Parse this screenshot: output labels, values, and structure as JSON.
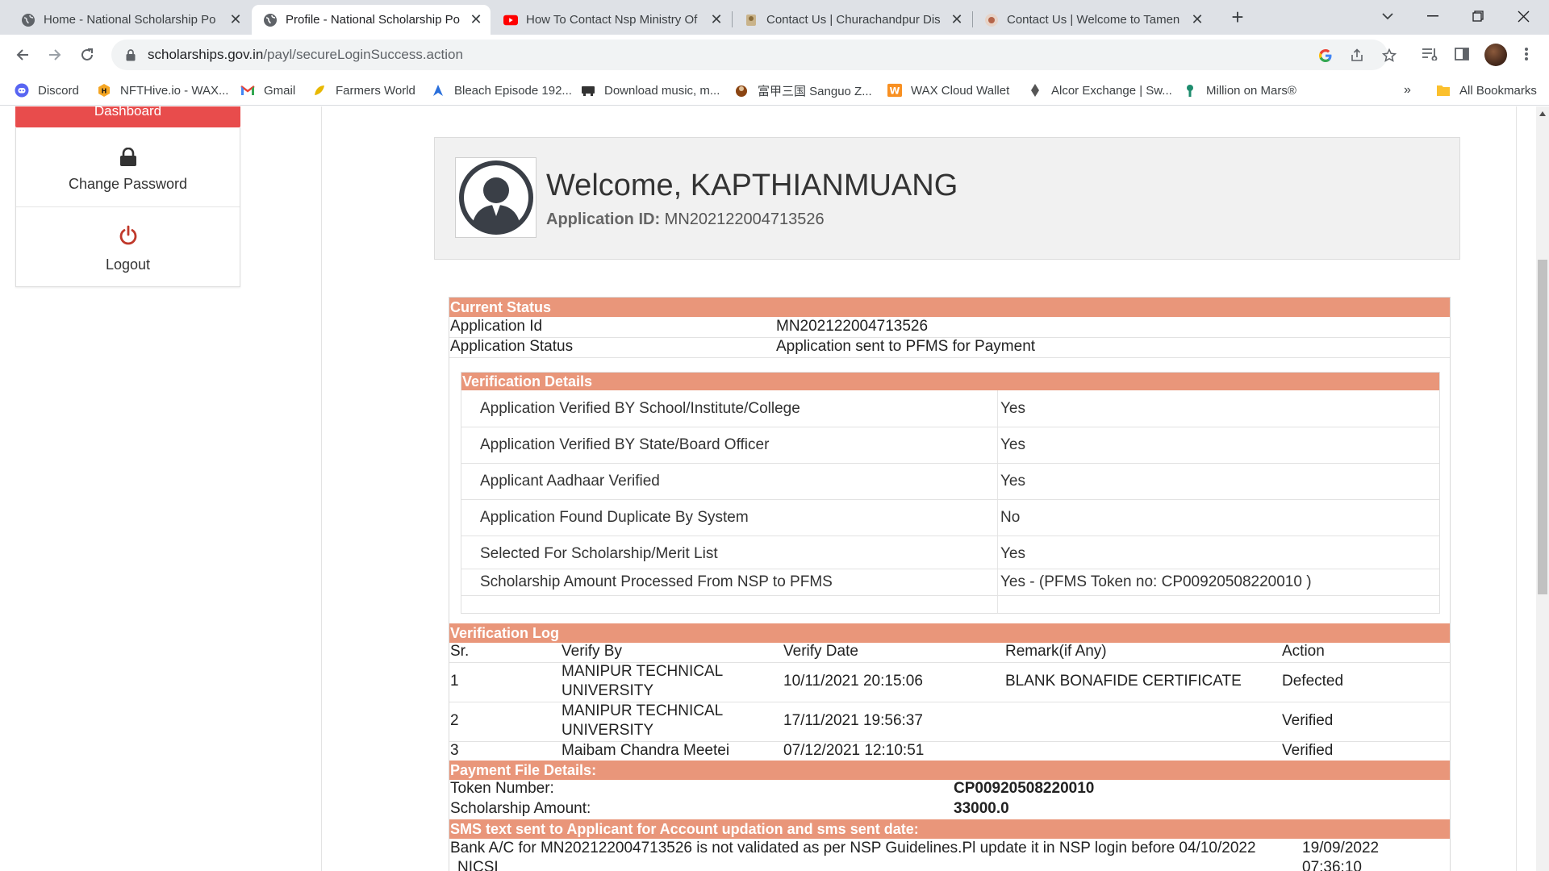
{
  "browser": {
    "tabs": [
      {
        "title": "Home - National Scholarship Po",
        "icon": "globe-icon",
        "active": false
      },
      {
        "title": "Profile - National Scholarship Po",
        "icon": "globe-icon",
        "active": true
      },
      {
        "title": "How To Contact Nsp Ministry Of",
        "icon": "youtube-icon",
        "active": false
      },
      {
        "title": "Contact Us | Churachandpur Dis",
        "icon": "emblem-icon",
        "active": false
      },
      {
        "title": "Contact Us | Welcome to Tamen",
        "icon": "emblem-icon",
        "active": false
      }
    ],
    "url_host": "scholarships.gov.in",
    "url_path": "/payl/secureLoginSuccess.action",
    "bookmarks": [
      {
        "label": "Discord",
        "icon": "discord-icon",
        "color": "#5865f2"
      },
      {
        "label": "NFTHive.io - WAX...",
        "icon": "nfthive-icon",
        "color": "#f5a623"
      },
      {
        "label": "Gmail",
        "icon": "gmail-icon",
        "color": "#ea4335"
      },
      {
        "label": "Farmers World",
        "icon": "farmers-world-icon",
        "color": "#e8b800"
      },
      {
        "label": "Bleach Episode 192...",
        "icon": "bleach-icon",
        "color": "#2a6fdb"
      },
      {
        "label": "Download music, m...",
        "icon": "download-icon",
        "color": "#333333"
      },
      {
        "label": "富甲三国 Sanguo Z...",
        "icon": "sanguo-icon",
        "color": "#8b4513"
      },
      {
        "label": "WAX Cloud Wallet",
        "icon": "wax-icon",
        "color": "#f89022"
      },
      {
        "label": "Alcor Exchange | Sw...",
        "icon": "alcor-icon",
        "color": "#555555"
      },
      {
        "label": "Million on Mars®",
        "icon": "mars-icon",
        "color": "#1e8c6e"
      }
    ],
    "all_bookmarks": "All Bookmarks",
    "more_bookmarks": "»"
  },
  "sidebar": {
    "dashboard_label": "Dashboard",
    "items": [
      {
        "label": "Change Password",
        "icon": "lock-icon"
      },
      {
        "label": "Logout",
        "icon": "power-icon"
      }
    ]
  },
  "welcome": {
    "title": "Welcome, KAPTHIANMUANG",
    "app_id_label": "Application ID:",
    "app_id_value": "MN202122004713526"
  },
  "current_status": {
    "heading": "Current Status",
    "rows": [
      {
        "label": "Application Id",
        "value": "MN202122004713526"
      },
      {
        "label": "Application Status",
        "value": "Application sent to PFMS for Payment"
      }
    ]
  },
  "verification_details": {
    "heading": "Verification Details",
    "rows": [
      {
        "label": "Application Verified BY School/Institute/College",
        "value": "Yes"
      },
      {
        "label": "Application Verified BY State/Board Officer",
        "value": "Yes"
      },
      {
        "label": "Applicant Aadhaar Verified",
        "value": "Yes"
      },
      {
        "label": "Application Found Duplicate By System",
        "value": "No"
      },
      {
        "label": "Selected For Scholarship/Merit List",
        "value": "Yes"
      },
      {
        "label": "Scholarship Amount Processed From NSP to PFMS",
        "value": "Yes - (PFMS Token no: CP00920508220010 )"
      }
    ]
  },
  "verification_log": {
    "heading": "Verification Log",
    "columns": [
      "Sr.",
      "Verify By",
      "Verify Date",
      "Remark(if Any)",
      "Action"
    ],
    "rows": [
      {
        "sr": "1",
        "verify_by_1": "MANIPUR TECHNICAL",
        "verify_by_2": "UNIVERSITY",
        "date": "10/11/2021 20:15:06",
        "remark": "BLANK BONAFIDE CERTIFICATE",
        "action": "Defected"
      },
      {
        "sr": "2",
        "verify_by_1": "MANIPUR TECHNICAL",
        "verify_by_2": "UNIVERSITY",
        "date": "17/11/2021 19:56:37",
        "remark": "",
        "action": "Verified"
      },
      {
        "sr": "3",
        "verify_by_1": "Maibam Chandra Meetei",
        "verify_by_2": "",
        "date": "07/12/2021 12:10:51",
        "remark": "",
        "action": "Verified"
      }
    ]
  },
  "payment_file": {
    "heading": "Payment File Details:",
    "token_label": "Token Number:",
    "token_value": "CP00920508220010",
    "amount_label": "Scholarship Amount:",
    "amount_value": "33000.0"
  },
  "sms": {
    "heading": "SMS text sent to Applicant for Account updation and sms sent date:",
    "text": "Bank A/C for MN202122004713526 is not validated as per NSP Guidelines.Pl update it in NSP login before 04/10/2022",
    "text_cont": "NICSI",
    "date": "19/09/2022",
    "time": "07:36:10"
  },
  "colors": {
    "section_bar": "#e9967a",
    "dashboard_button": "#e84c4c",
    "logout_icon": "#c0392b"
  }
}
